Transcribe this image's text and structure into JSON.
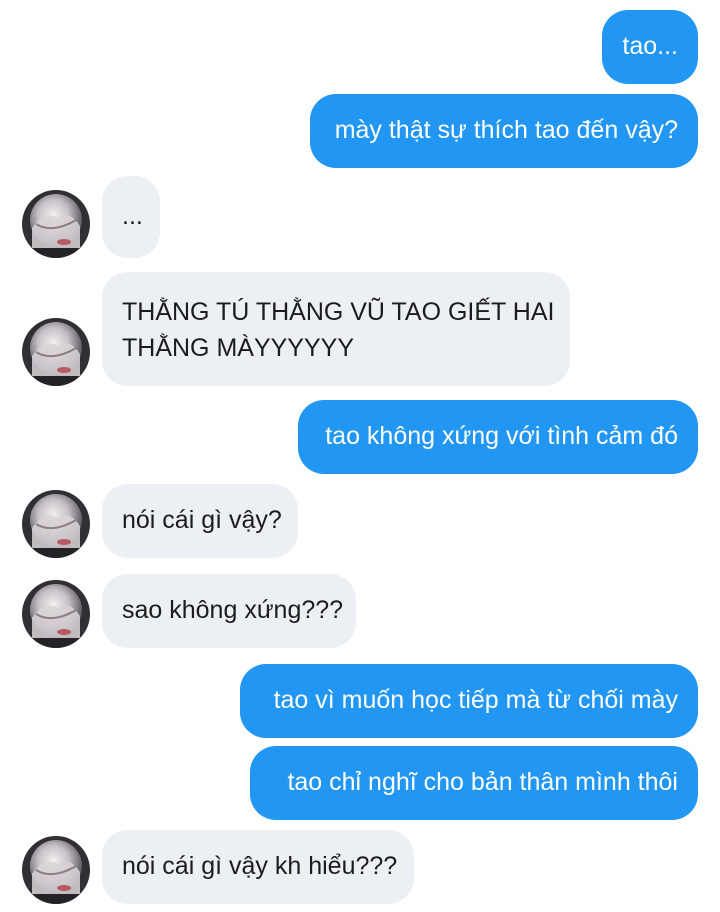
{
  "messages": [
    {
      "side": "sent",
      "text": "tao..."
    },
    {
      "side": "sent",
      "text": "mày thật sự thích tao đến vậy?"
    },
    {
      "side": "received",
      "text": "..."
    },
    {
      "side": "received",
      "lines": [
        "THẰNG TÚ THẰNG VŨ TAO GIẾT HAI",
        "THẰNG MÀYYYYYY"
      ]
    },
    {
      "side": "sent",
      "text": "tao không xứng với tình cảm đó"
    },
    {
      "side": "received",
      "text": "nói cái gì vậy?"
    },
    {
      "side": "received",
      "text": "sao không xứng???"
    },
    {
      "side": "sent",
      "text": "tao vì muốn học tiếp mà từ chối mày"
    },
    {
      "side": "sent",
      "text": "tao chỉ nghĩ cho bản thân mình thôi"
    },
    {
      "side": "received",
      "text": "nói cái gì vậy kh hiểu???"
    }
  ],
  "colors": {
    "sent_bubble": "#2196f3",
    "received_bubble": "#eceff3"
  },
  "icons": {
    "avatar": "contact-avatar-photo"
  }
}
